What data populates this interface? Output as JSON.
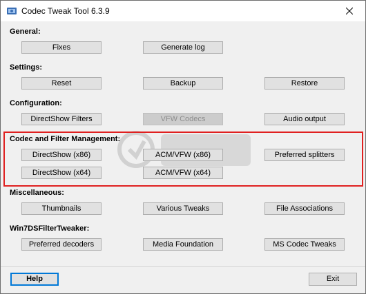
{
  "window": {
    "title": "Codec Tweak Tool 6.3.9"
  },
  "sections": {
    "general": {
      "label": "General:",
      "fixes": "Fixes",
      "generate_log": "Generate log"
    },
    "settings": {
      "label": "Settings:",
      "reset": "Reset",
      "backup": "Backup",
      "restore": "Restore"
    },
    "configuration": {
      "label": "Configuration:",
      "directshow_filters": "DirectShow Filters",
      "vfw_codecs": "VFW Codecs",
      "audio_output": "Audio output"
    },
    "codec_management": {
      "label": "Codec and Filter Management:",
      "directshow_x86": "DirectShow  (x86)",
      "acm_vfw_x86": "ACM/VFW  (x86)",
      "preferred_splitters": "Preferred splitters",
      "directshow_x64": "DirectShow  (x64)",
      "acm_vfw_x64": "ACM/VFW  (x64)"
    },
    "miscellaneous": {
      "label": "Miscellaneous:",
      "thumbnails": "Thumbnails",
      "various_tweaks": "Various Tweaks",
      "file_associations": "File Associations"
    },
    "win7ds": {
      "label": "Win7DSFilterTweaker:",
      "preferred_decoders": "Preferred decoders",
      "media_foundation": "Media Foundation",
      "ms_codec_tweaks": "MS Codec Tweaks"
    }
  },
  "footer": {
    "help": "Help",
    "exit": "Exit"
  },
  "colors": {
    "highlight_border": "#e02020",
    "default_button_border": "#0078d7"
  },
  "states": {
    "vfw_codecs_disabled": true
  },
  "icons": {
    "app": "codec-tweak-app-icon",
    "close": "close-icon"
  }
}
